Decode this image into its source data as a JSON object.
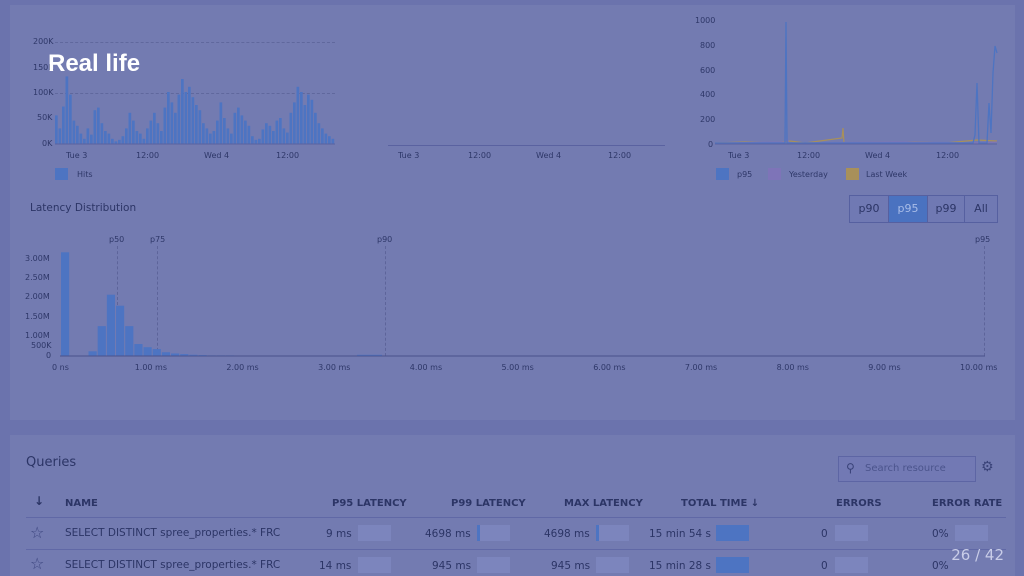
{
  "overlay_title": "Real life",
  "page_number": "26 / 42",
  "hits_chart": {
    "y_ticks": [
      "200K",
      "150K",
      "100K",
      "50K",
      "0K"
    ],
    "x_ticks": [
      "Tue 3",
      "12:00",
      "Wed 4",
      "12:00"
    ],
    "legend": "Hits",
    "color": "#4d74c2",
    "values_k": [
      55,
      30,
      72,
      130,
      95,
      45,
      35,
      20,
      10,
      30,
      18,
      65,
      70,
      40,
      25,
      20,
      10,
      5,
      8,
      15,
      30,
      60,
      45,
      25,
      20,
      10,
      30,
      45,
      60,
      40,
      25,
      70,
      100,
      80,
      60,
      95,
      125,
      100,
      110,
      90,
      75,
      65,
      40,
      30,
      20,
      25,
      45,
      80,
      50,
      30,
      20,
      60,
      70,
      55,
      45,
      35,
      15,
      8,
      10,
      28,
      40,
      35,
      25,
      45,
      50,
      30,
      22,
      60,
      80,
      110,
      100,
      75,
      95,
      85,
      60,
      40,
      30,
      20,
      15,
      10
    ]
  },
  "blank_chart": {
    "x_ticks": [
      "Tue 3",
      "12:00",
      "Wed 4",
      "12:00"
    ]
  },
  "latency_chart": {
    "y_ticks": [
      "1000",
      "800",
      "600",
      "400",
      "200",
      "0"
    ],
    "x_ticks": [
      "Tue 3",
      "12:00",
      "Wed 4",
      "12:00"
    ],
    "legend": [
      "p95",
      "Yesterday",
      "Last Week"
    ],
    "colors": [
      "#4d74c2",
      "#7e74b8",
      "#a8905a"
    ]
  },
  "distribution": {
    "title": "Latency Distribution",
    "toggle": [
      "p90",
      "p95",
      "p99",
      "All"
    ],
    "active_toggle": "p95",
    "markers": [
      "p50",
      "p75",
      "p90",
      "p95"
    ],
    "y_ticks": [
      "3.00M",
      "2.50M",
      "2.00M",
      "1.50M",
      "1.00M",
      "500K",
      "0"
    ],
    "x_ticks": [
      "0 ns",
      "1.00 ms",
      "2.00 ms",
      "3.00 ms",
      "4.00 ms",
      "5.00 ms",
      "6.00 ms",
      "7.00 ms",
      "8.00 ms",
      "9.00 ms",
      "10.00 ms"
    ],
    "values_m": [
      3.3,
      0,
      0,
      0.15,
      0.95,
      1.95,
      1.6,
      0.95,
      0.38,
      0.28,
      0.22,
      0.12,
      0.08,
      0.06,
      0.04,
      0.03,
      0.02,
      0.02,
      0.02
    ]
  },
  "queries": {
    "title": "Queries",
    "search_placeholder": "Search resource",
    "sort_arrow": "↓",
    "columns": [
      "NAME",
      "P95 LATENCY",
      "P99 LATENCY",
      "MAX LATENCY",
      "TOTAL TIME ↓",
      "ERRORS",
      "ERROR RATE"
    ],
    "rows": [
      {
        "name": "SELECT DISTINCT spree_properties.* FRC",
        "p95": "9 ms",
        "p99": "4698 ms",
        "max": "4698 ms",
        "total": "15 min 54 s",
        "errors": "0",
        "rate": "0%"
      },
      {
        "name": "SELECT DISTINCT spree_properties.* FRC",
        "p95": "14 ms",
        "p99": "945 ms",
        "max": "945 ms",
        "total": "15 min 28 s",
        "errors": "0",
        "rate": "0%"
      }
    ]
  }
}
